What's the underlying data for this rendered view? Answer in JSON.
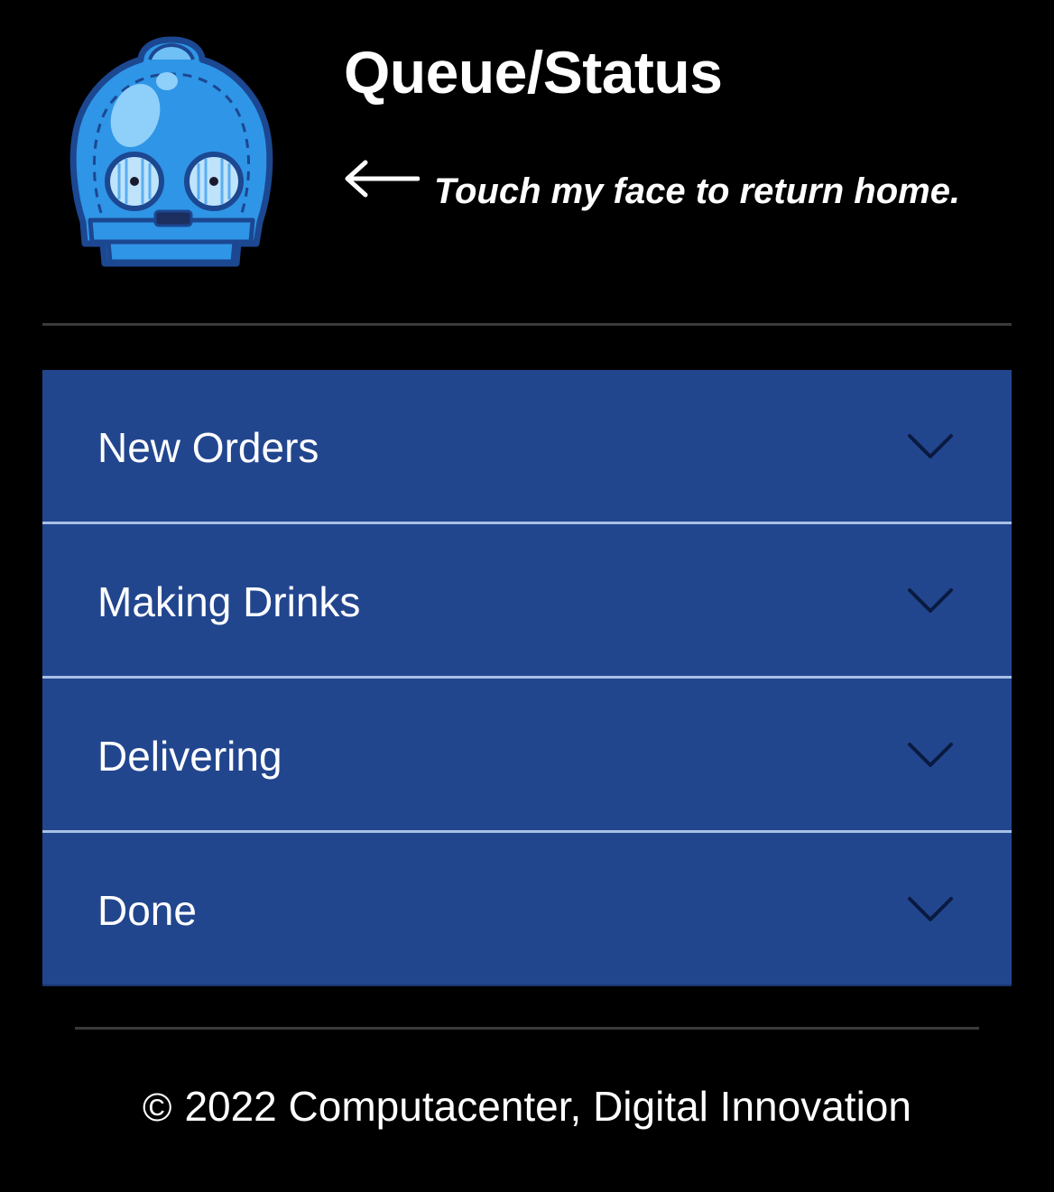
{
  "header": {
    "title": "Queue/Status",
    "hint": "Touch my face to return home.",
    "home_icon": "robot-face-icon",
    "hint_icon": "left-arrow-icon"
  },
  "queue": {
    "sections": [
      {
        "label": "New Orders",
        "icon": "chevron-down-icon"
      },
      {
        "label": "Making Drinks",
        "icon": "chevron-down-icon"
      },
      {
        "label": "Delivering",
        "icon": "chevron-down-icon"
      },
      {
        "label": "Done",
        "icon": "chevron-down-icon"
      }
    ]
  },
  "footer": {
    "symbol": "©",
    "text": "2022 Computacenter, Digital Innovation"
  },
  "colors": {
    "background": "#000000",
    "panel": "#22468e",
    "panel_divider": "#a8c0e6",
    "face_blue": "#2f95e6",
    "face_outline": "#1c4791",
    "chevron": "#0a1a40",
    "text": "#ffffff"
  }
}
